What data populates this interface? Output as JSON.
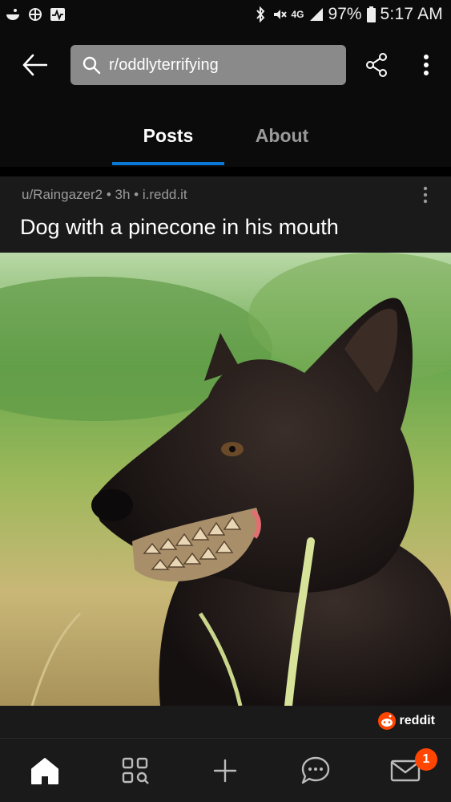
{
  "status_bar": {
    "battery": "97%",
    "time": "5:17 AM",
    "network": "4G"
  },
  "header": {
    "search_text": "r/oddlyterrifying"
  },
  "tabs": [
    {
      "label": "Posts",
      "active": true
    },
    {
      "label": "About",
      "active": false
    }
  ],
  "post": {
    "meta": "u/Raingazer2 • 3h • i.redd.it",
    "title": "Dog with a pinecone in his mouth",
    "watermark": "reddit"
  },
  "bottom_nav": {
    "items": [
      "home-icon",
      "discover-icon",
      "create-icon",
      "chat-icon",
      "inbox-icon"
    ],
    "inbox_badge": "1"
  },
  "colors": {
    "accent": "#0a78d6",
    "brand": "#ff4500",
    "surface": "#1a1a1b",
    "header_bg": "#0b0b0b"
  }
}
